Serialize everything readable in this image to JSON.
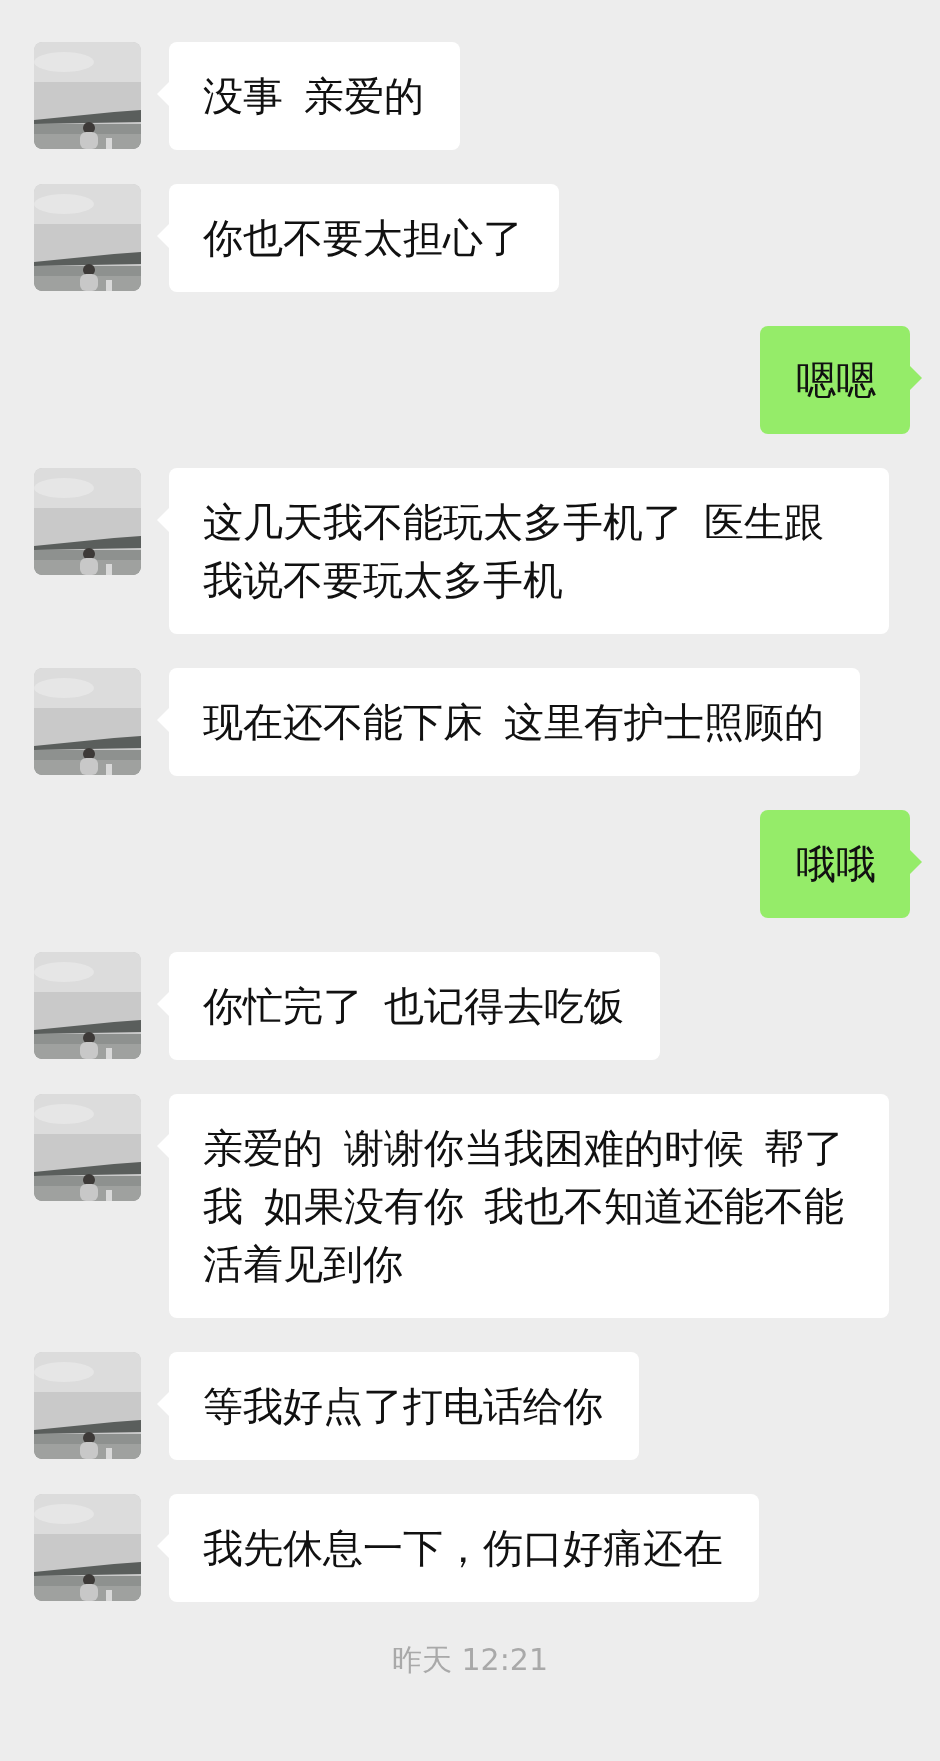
{
  "messages": [
    {
      "kind": "received",
      "text": "没事  亲爱的"
    },
    {
      "kind": "received",
      "text": "你也不要太担心了"
    },
    {
      "kind": "sent",
      "text": "嗯嗯"
    },
    {
      "kind": "received",
      "text": "这几天我不能玩太多手机了  医生跟我说不要玩太多手机"
    },
    {
      "kind": "received",
      "text": "现在还不能下床 这里有护士照顾的"
    },
    {
      "kind": "sent",
      "text": "哦哦"
    },
    {
      "kind": "received",
      "text": "你忙完了  也记得去吃饭"
    },
    {
      "kind": "received",
      "text": "亲爱的  谢谢你当我困难的时候  帮了我 如果没有你  我也不知道还能不能活着见到你"
    },
    {
      "kind": "received",
      "text": "等我好点了打电话给你"
    },
    {
      "kind": "received",
      "text": "我先休息一下，伤口好痛还在"
    }
  ],
  "timestamp": "昨天 12:21"
}
